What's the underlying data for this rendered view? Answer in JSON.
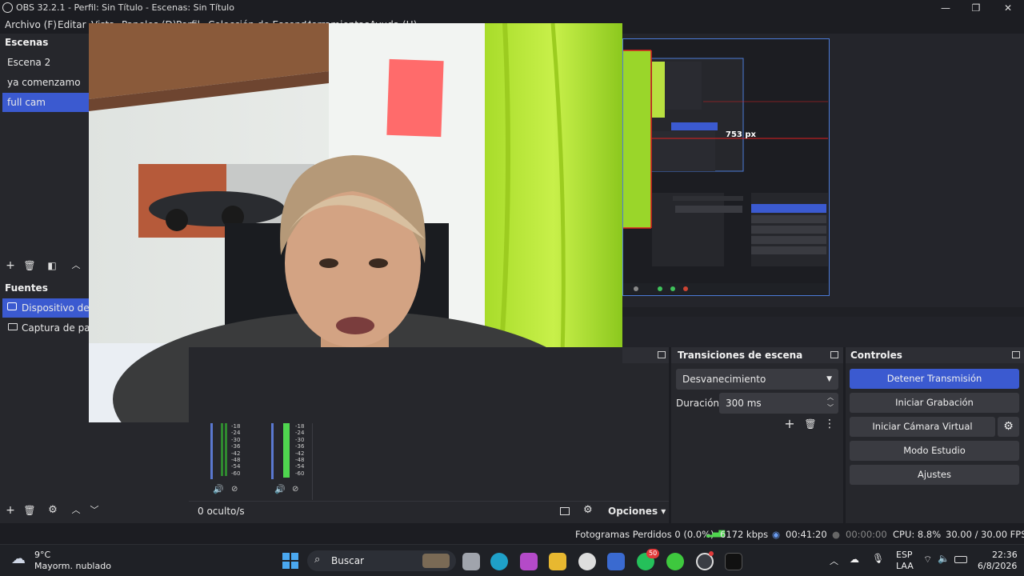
{
  "window": {
    "title": "OBS 32.2.1 - Perfil: Sin Título - Escenas: Sin Título",
    "minimize": "—",
    "maximize": "❐",
    "close": "✕"
  },
  "menu": [
    "Archivo (F)",
    "Editar",
    "Vista",
    "Paneles (D)",
    "Perfil",
    "Colección de Escenas",
    "Herramientas",
    "Ayuda (H)"
  ],
  "scenes": {
    "title": "Escenas",
    "items": [
      {
        "label": "Escena 2",
        "selected": false
      },
      {
        "label": "ya comenzamo",
        "selected": false
      },
      {
        "label": "full cam",
        "selected": true
      }
    ]
  },
  "sources": {
    "title": "Fuentes",
    "items": [
      {
        "label": "Dispositivo de captura de vídeo",
        "icon": "camera-icon",
        "selected": true
      },
      {
        "label": "Captura de pantalla",
        "icon": "monitor-icon",
        "selected": false
      }
    ]
  },
  "preview": {
    "measure_label": "753 px"
  },
  "mixer": {
    "ticks": [
      "-18",
      "-24",
      "-30",
      "-36",
      "-42",
      "-48",
      "-54",
      "-60"
    ],
    "channel_count": 2,
    "hidden_label": "0 oculto/s",
    "options_label": "Opciones"
  },
  "transitions": {
    "title": "Transiciones de escena",
    "selected": "Desvanecimiento",
    "duration_label": "Duración",
    "duration_value": "300 ms"
  },
  "controls": {
    "title": "Controles",
    "stop_stream": "Detener Transmisión",
    "start_recording": "Iniciar Grabación",
    "start_virtualcam": "Iniciar Cámara Virtual",
    "studio_mode": "Modo Estudio",
    "settings": "Ajustes"
  },
  "status": {
    "dropped": "Fotogramas Perdidos 0 (0.0%)",
    "bitrate": "6172 kbps",
    "stream_time": "00:41:20",
    "rec_time": "00:00:00",
    "cpu": "CPU: 8.8%",
    "fps": "30.00 / 30.00 FPS",
    "accent": "#3b5ad0"
  },
  "taskbar": {
    "weather_temp": "9°C",
    "weather_desc": "Mayorm. nublado",
    "search": "Buscar",
    "whatsapp_badge": "50",
    "lang_top": "ESP",
    "lang_bottom": "LAA",
    "time": "22:36",
    "date": "6/8/2026"
  }
}
